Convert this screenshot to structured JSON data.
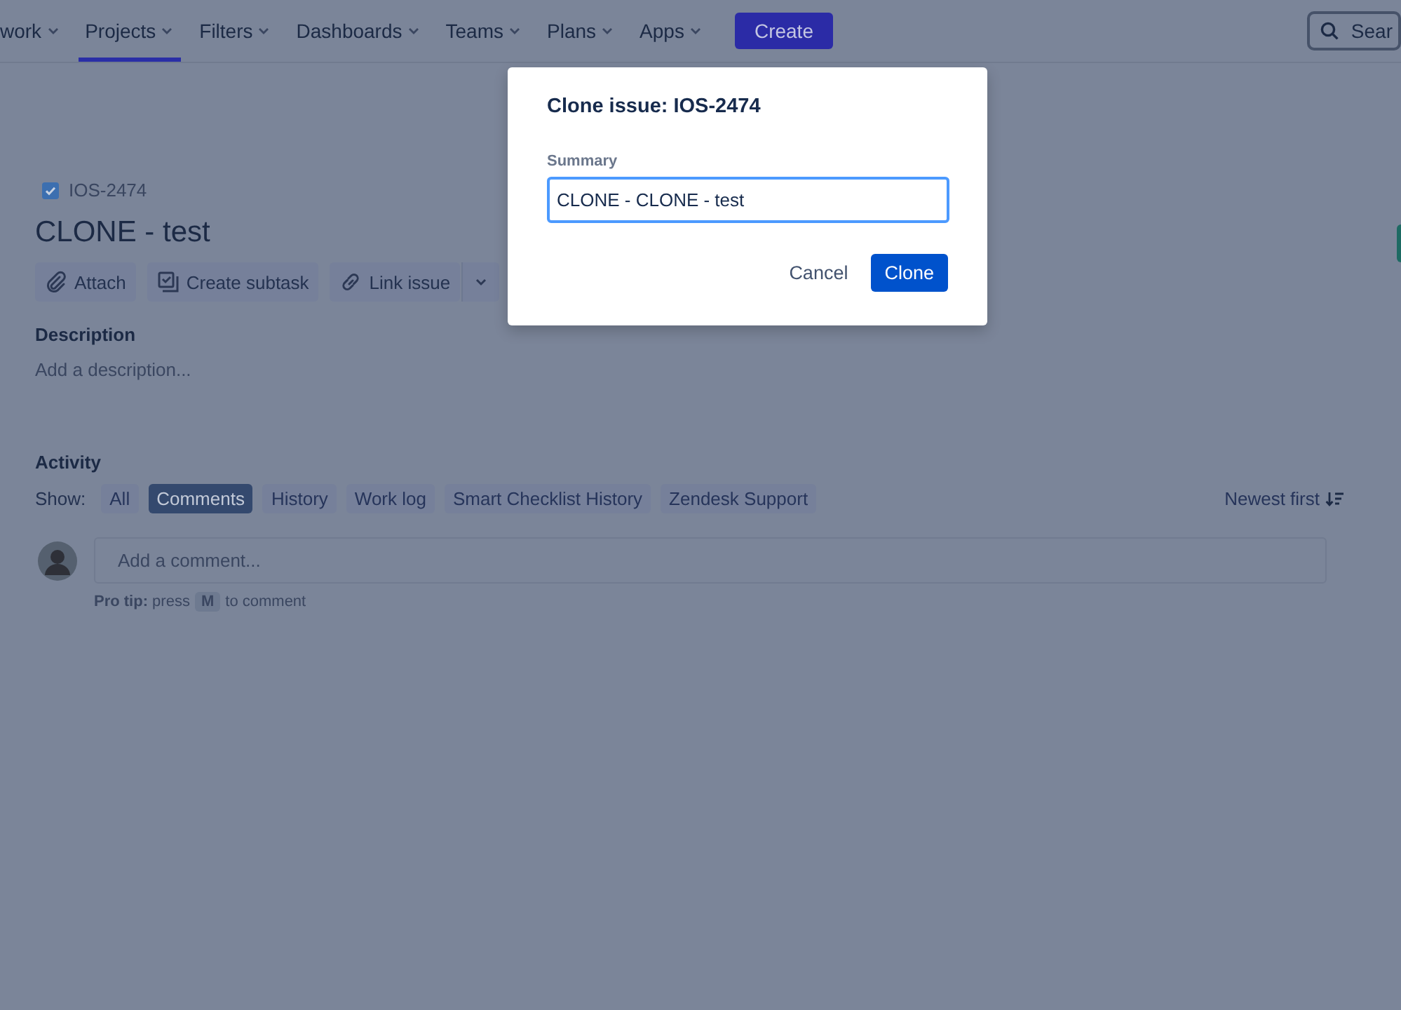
{
  "nav": {
    "items": [
      {
        "label": "work",
        "selected": false
      },
      {
        "label": "Projects",
        "selected": true
      },
      {
        "label": "Filters",
        "selected": false
      },
      {
        "label": "Dashboards",
        "selected": false
      },
      {
        "label": "Teams",
        "selected": false
      },
      {
        "label": "Plans",
        "selected": false
      },
      {
        "label": "Apps",
        "selected": false
      }
    ],
    "create": "Create",
    "search": {
      "placeholder": "Sear"
    }
  },
  "issue": {
    "key": "IOS-2474",
    "title": "CLONE - test",
    "actions": [
      {
        "kind": "attach",
        "label": "Attach"
      },
      {
        "kind": "subtask",
        "label": "Create subtask"
      },
      {
        "kind": "link",
        "label": "Link issue"
      },
      {
        "kind": "more"
      }
    ],
    "description": {
      "heading": "Description",
      "placeholder": "Add a description..."
    }
  },
  "activity": {
    "heading": "Activity",
    "show_label": "Show:",
    "filters": [
      {
        "label": "All",
        "selected": false
      },
      {
        "label": "Comments",
        "selected": true
      },
      {
        "label": "History",
        "selected": false
      },
      {
        "label": "Work log",
        "selected": false
      },
      {
        "label": "Smart Checklist History",
        "selected": false
      },
      {
        "label": "Zendesk Support",
        "selected": false
      }
    ],
    "sort": "Newest first",
    "comment": {
      "placeholder": "Add a comment..."
    },
    "pro_tip": {
      "lead": "**Pro tip:** press",
      "key": "M",
      "tail": "to comment"
    }
  },
  "dialog": {
    "title": "Clone issue: IOS-2474",
    "field_label": "Summary",
    "value": "CLONE - CLONE - test",
    "cancel": "Cancel",
    "confirm": "Clone"
  }
}
